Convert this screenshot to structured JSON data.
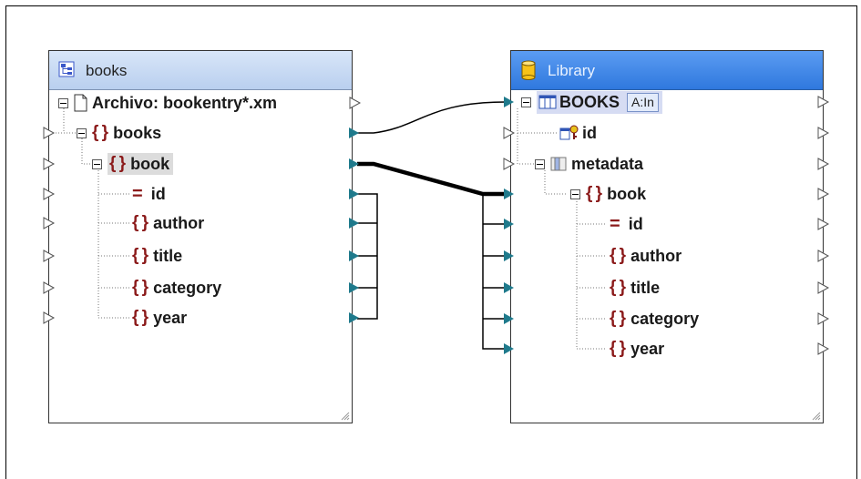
{
  "source_component": {
    "title": "books",
    "file_label": "Archivo: bookentry*.xm",
    "root": "books",
    "item": "book",
    "fields": [
      "id",
      "author",
      "title",
      "category",
      "year"
    ]
  },
  "target_component": {
    "title": "Library",
    "table": "BOOKS",
    "table_badge": "A:In",
    "id_field": "id",
    "metadata": "metadata",
    "item": "book",
    "fields": [
      "id",
      "author",
      "title",
      "category",
      "year"
    ]
  },
  "colors": {
    "connector": "#1f7a8c",
    "element_icon": "#8b1a1a",
    "library_header": "#3c83e3",
    "source_header": "#c6d8f2"
  },
  "icons": {
    "source": "schema-icon",
    "target": "database-icon",
    "file": "file-icon",
    "table": "table-icon",
    "key": "primary-key-icon",
    "element": "element-icon",
    "attribute": "attribute-icon"
  }
}
